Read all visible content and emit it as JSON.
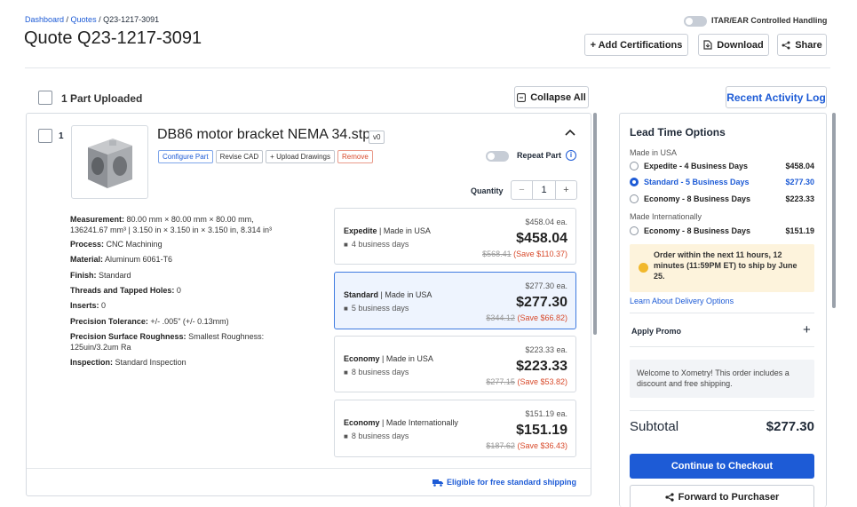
{
  "breadcrumb": {
    "dashboard": "Dashboard",
    "sep1": " / ",
    "quotes": "Quotes",
    "sep2": " / ",
    "current": "Q23-1217-3091"
  },
  "page_title": "Quote Q23-1217-3091",
  "itar_label": "ITAR/EAR Controlled Handling",
  "toolbar": {
    "add_cert": "+ Add Certifications",
    "download": "Download",
    "share": "Share"
  },
  "parts_header": {
    "label": "1 Part Uploaded",
    "collapse": "Collapse All",
    "activity": "Recent Activity Log"
  },
  "part": {
    "index": "1",
    "name": "DB86 motor bracket NEMA 34.stp",
    "version": "v0",
    "actions": [
      "Configure Part",
      "Revise CAD",
      "+ Upload Drawings",
      "Remove"
    ],
    "repeat_label": "Repeat Part",
    "quantity_label": "Quantity",
    "quantity": "1",
    "minus": "−",
    "plus": "+",
    "specs": {
      "measurement_label": "Measurement:",
      "measurement_1": "80.00 mm × 80.00 mm × 80.00 mm,",
      "measurement_2": "136241.67 mm³  |  3.150 in × 3.150 in × 3.150 in, 8.314 in³",
      "process_label": "Process:",
      "process": "CNC Machining",
      "material_label": "Material:",
      "material": "Aluminum 6061-T6",
      "finish_label": "Finish:",
      "finish": "Standard",
      "threads_label": "Threads and Tapped Holes:",
      "threads": "0",
      "inserts_label": "Inserts:",
      "inserts": "0",
      "tolerance_label": "Precision Tolerance:",
      "tolerance": "+/- .005\" (+/- 0.13mm)",
      "roughness_label": "Precision Surface Roughness:",
      "roughness_1": "Smallest Roughness:",
      "roughness_2": "125uin/3.2um Ra",
      "inspection_label": "Inspection:",
      "inspection": "Standard Inspection"
    },
    "options": [
      {
        "tier": "Expedite",
        "origin": "Made in USA",
        "days": "4 business days",
        "each": "$458.04 ea.",
        "price": "$458.04",
        "was": "$568.41",
        "save": "(Save $110.37)"
      },
      {
        "tier": "Standard",
        "origin": "Made in USA",
        "days": "5 business days",
        "each": "$277.30 ea.",
        "price": "$277.30",
        "was": "$344.12",
        "save": "(Save $66.82)"
      },
      {
        "tier": "Economy",
        "origin": "Made in USA",
        "days": "8 business days",
        "each": "$223.33 ea.",
        "price": "$223.33",
        "was": "$277.15",
        "save": "(Save $53.82)"
      },
      {
        "tier": "Economy",
        "origin": "Made Internationally",
        "days": "8 business days",
        "each": "$151.19 ea.",
        "price": "$151.19",
        "was": "$187.62",
        "save": "(Save $36.43)"
      }
    ],
    "option_sep": " | ",
    "shipping": "Eligible for free standard shipping"
  },
  "sidebar": {
    "title": "Lead Time Options",
    "usa_label": "Made in USA",
    "usa_options": [
      {
        "label": "Expedite - 4 Business Days",
        "price": "$458.04",
        "selected": false
      },
      {
        "label": "Standard - 5 Business Days",
        "price": "$277.30",
        "selected": true
      },
      {
        "label": "Economy - 8 Business Days",
        "price": "$223.33",
        "selected": false
      }
    ],
    "intl_label": "Made Internationally",
    "intl_options": [
      {
        "label": "Economy - 8 Business Days",
        "price": "$151.19",
        "selected": false
      }
    ],
    "notice": "Order within the next 11 hours, 12 minutes (11:59PM ET) to ship by June 25.",
    "delivery_link": "Learn About Delivery Options",
    "promo": "Apply Promo",
    "promo_plus": "+",
    "welcome": "Welcome to Xometry! This order includes a discount and free shipping.",
    "subtotal_label": "Subtotal",
    "subtotal": "$277.30",
    "checkout": "Continue to Checkout",
    "forward": "Forward to Purchaser"
  },
  "colors": {
    "accent": "#1d5bd6",
    "selected_bg": "#eef4fe",
    "notice_bg": "#fdf3dc",
    "save_red": "#d84a2b"
  }
}
